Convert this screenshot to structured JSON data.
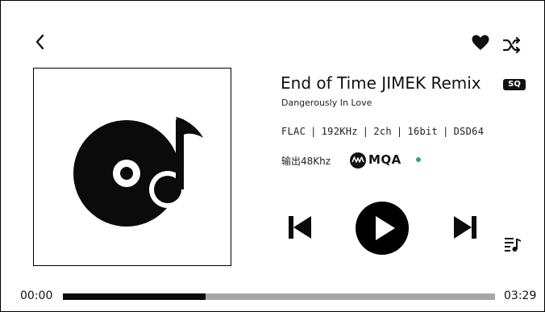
{
  "player": {
    "title": "End of Time JIMEK Remix",
    "album": "Dangerously In Love",
    "quality_badge": "SQ",
    "specs": {
      "format": "FLAC",
      "sample_rate": "192KHz",
      "channels": "2ch",
      "bit_depth": "16bit",
      "dsd": "DSD64",
      "separator": "|"
    },
    "output_label": "输出48Khz",
    "mqa_label": "MQA",
    "mqa_status_color": "#34a853",
    "favorited": true,
    "icons": {
      "back": "chevron-left-icon",
      "favorite": "heart-icon",
      "shuffle": "shuffle-icon",
      "cover": "music-disc-icon",
      "previous": "skip-previous-icon",
      "play": "play-icon",
      "next": "skip-next-icon",
      "queue": "playlist-icon"
    }
  },
  "playback": {
    "elapsed": "00:00",
    "duration": "03:29",
    "progress_fraction": 0.33
  }
}
